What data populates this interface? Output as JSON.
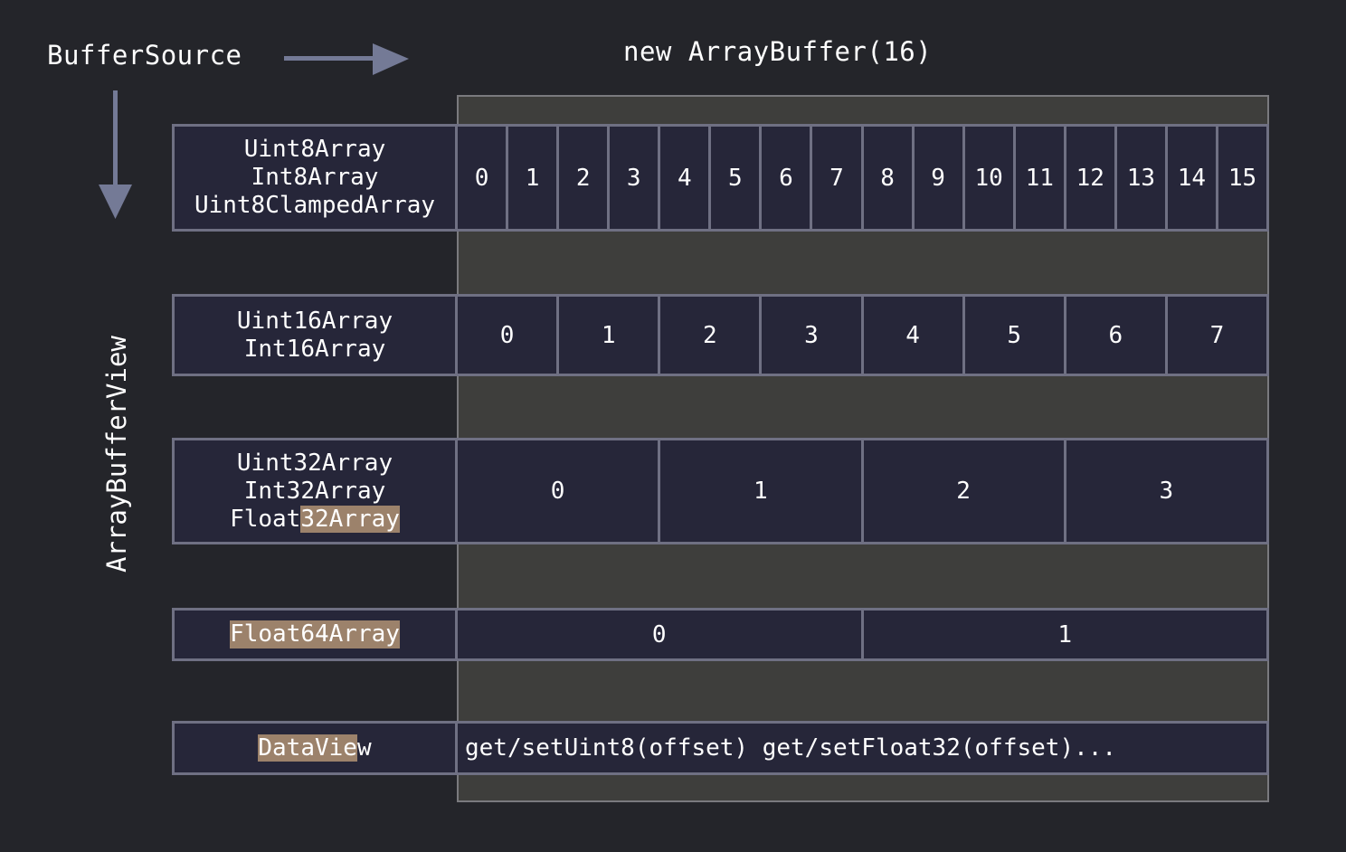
{
  "header": {
    "buffer_source": "BufferSource",
    "array_buffer": "new ArrayBuffer(16)",
    "array_buffer_view": "ArrayBufferView"
  },
  "rows": [
    {
      "labels": [
        "Uint8Array",
        "Int8Array",
        "Uint8ClampedArray"
      ],
      "cells": [
        "0",
        "1",
        "2",
        "3",
        "4",
        "5",
        "6",
        "7",
        "8",
        "9",
        "10",
        "11",
        "12",
        "13",
        "14",
        "15"
      ]
    },
    {
      "labels": [
        "Uint16Array",
        "Int16Array"
      ],
      "cells": [
        "0",
        "1",
        "2",
        "3",
        "4",
        "5",
        "6",
        "7"
      ]
    },
    {
      "labels": [
        "Uint32Array",
        "Int32Array"
      ],
      "label_float_prefix": "Float",
      "label_float_highlight": "32Array",
      "cells": [
        "0",
        "1",
        "2",
        "3"
      ]
    },
    {
      "label_highlight": "Float64Array",
      "cells": [
        "0",
        "1"
      ]
    },
    {
      "label_highlight": "DataVie",
      "label_rest": "w",
      "methods": "get/setUint8(offset) get/setFloat32(offset)..."
    }
  ],
  "colors": {
    "background": "#24252a",
    "buffer": "#3e3e3c",
    "cell": "#262639",
    "border": "#6f7083",
    "highlight": "#9c826b",
    "arrow": "#747a96"
  }
}
